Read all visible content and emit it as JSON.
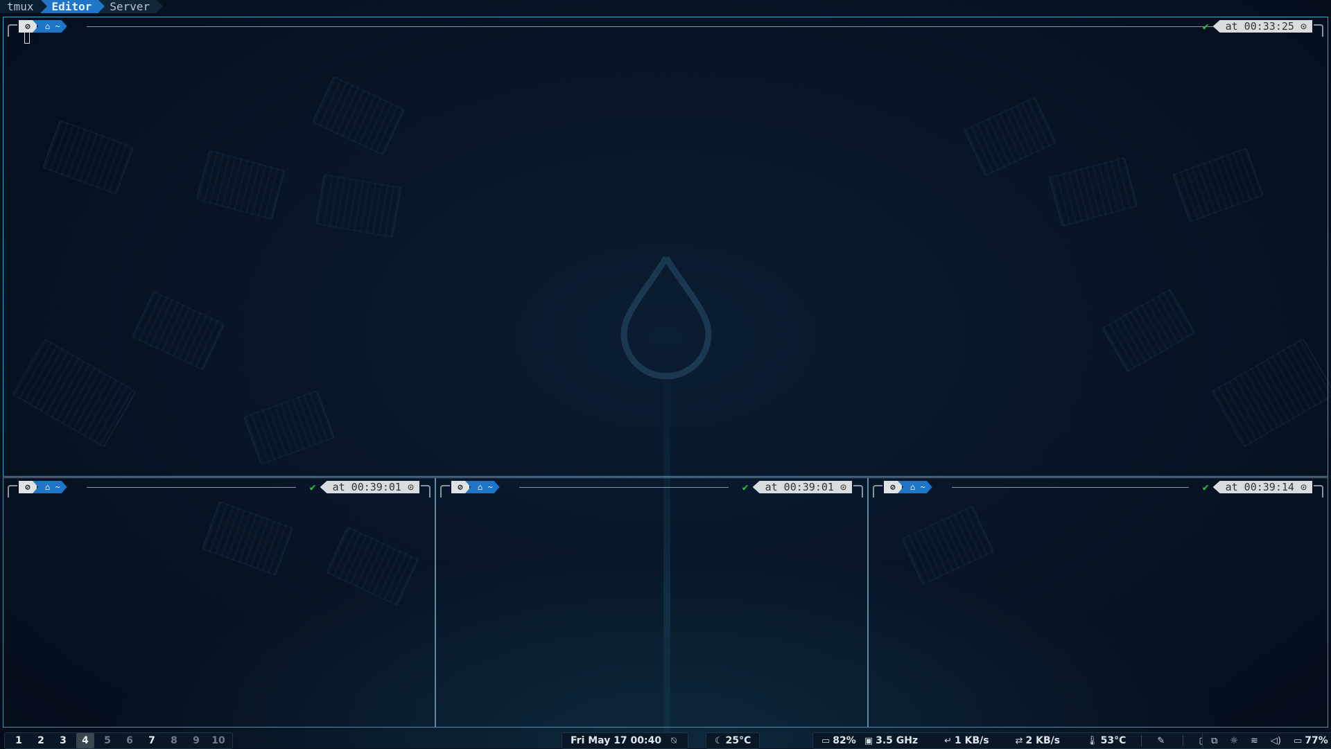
{
  "tmux": {
    "session": "tmux",
    "windows": [
      {
        "label": "Editor",
        "active": true
      },
      {
        "label": "Server",
        "active": false
      }
    ]
  },
  "panes": [
    {
      "id": "top",
      "icon": "⊘",
      "dir": "⌂ ~",
      "ok": "✔",
      "time": "at 00:33:25 ⊙"
    },
    {
      "id": "bottom-left",
      "icon": "⊘",
      "dir": "⌂ ~",
      "ok": "✔",
      "time": "at 00:39:01 ⊙"
    },
    {
      "id": "bottom-middle",
      "icon": "⊘",
      "dir": "⌂ ~",
      "ok": "✔",
      "time": "at 00:39:01 ⊙"
    },
    {
      "id": "bottom-right",
      "icon": "⊘",
      "dir": "⌂ ~",
      "ok": "✔",
      "time": "at 00:39:14 ⊙"
    }
  ],
  "workspaces": [
    "1",
    "2",
    "3",
    "4",
    "5",
    "6",
    "7",
    "8",
    "9",
    "10"
  ],
  "bar": {
    "datetime": "Fri May 17  00:40",
    "weather_temp": "25°C",
    "memory": "82%",
    "cpu_freq": "3.5 GHz",
    "net_down": "1 KB/s",
    "net_up": "2 KB/s",
    "cpu_temp": "53°C",
    "battery": "77%"
  },
  "icons": {
    "notification": "notification-off-icon",
    "weather": "moon-cloud-icon",
    "memory": "memory-icon",
    "cpu": "cpu-icon",
    "download": "download-icon",
    "upload": "upload-icon",
    "thermometer": "thermometer-icon",
    "picker": "color-picker-icon",
    "clipboard": "clipboard-icon",
    "screen": "screen-icon",
    "brightness": "brightness-icon",
    "wifi": "wifi-icon",
    "volume": "volume-icon",
    "battery": "battery-icon"
  },
  "colors": {
    "accent": "#1f76c8",
    "ok": "#2fbf4a",
    "pane_border": "#3aa6c7"
  }
}
